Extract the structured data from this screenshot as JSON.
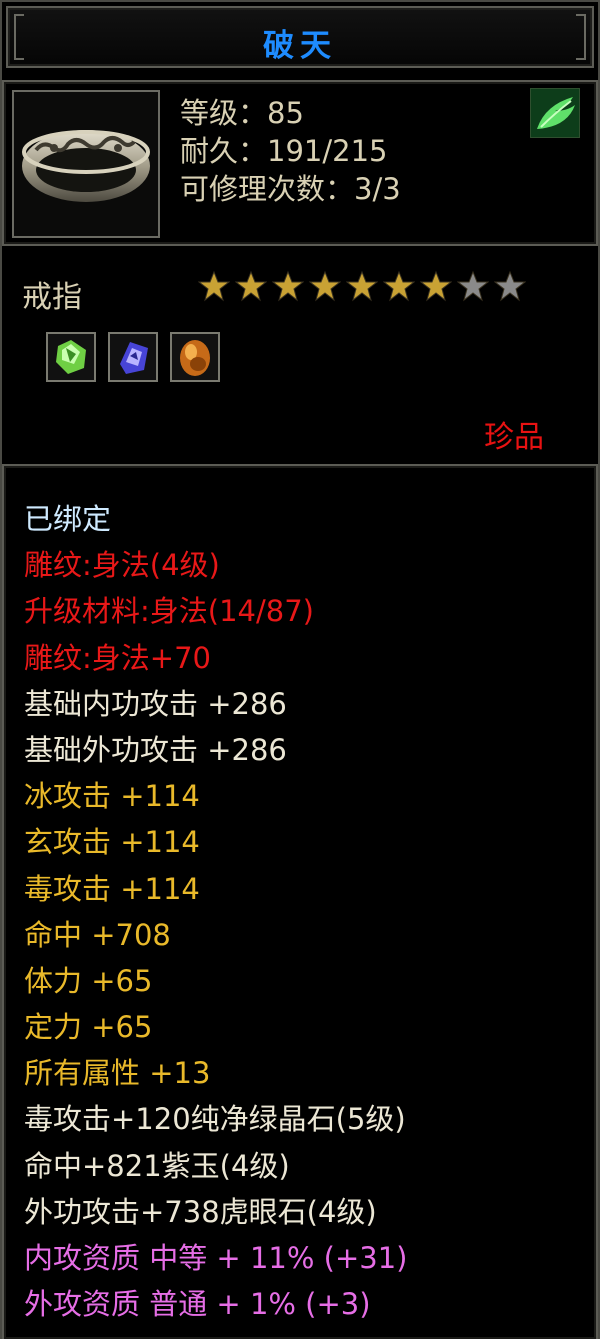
{
  "title": "破天",
  "header": {
    "level": "等级：85",
    "durability": "耐久：191/215",
    "repair_count": "可修理次数：3/3",
    "element_icon": "wind-leaf-icon",
    "item_icon": "ring-icon"
  },
  "item_type": "戒指",
  "stars": {
    "filled": 7,
    "total": 9,
    "filled_color": "#c9a234",
    "empty_color": "#8a8a8a"
  },
  "gems": [
    {
      "name": "green-crystal-gem-icon",
      "color": "#7ad84a"
    },
    {
      "name": "purple-jade-gem-icon",
      "color": "#5a58e6"
    },
    {
      "name": "tiger-eye-gem-icon",
      "color": "#d2781e"
    }
  ],
  "rarity": "珍品",
  "properties": [
    {
      "text": "已绑定",
      "color": "cyan"
    },
    {
      "text": "雕纹:身法(4级)",
      "color": "red"
    },
    {
      "text": "升级材料:身法(14/87)",
      "color": "red"
    },
    {
      "text": "雕纹:身法+70",
      "color": "red"
    },
    {
      "text": "基础内功攻击 +286",
      "color": "white"
    },
    {
      "text": "基础外功攻击 +286",
      "color": "white"
    },
    {
      "text": "冰攻击 +114",
      "color": "yellow"
    },
    {
      "text": "玄攻击 +114",
      "color": "yellow"
    },
    {
      "text": "毒攻击 +114",
      "color": "yellow"
    },
    {
      "text": "命中 +708",
      "color": "yellow"
    },
    {
      "text": "体力 +65",
      "color": "yellow"
    },
    {
      "text": "定力 +65",
      "color": "yellow"
    },
    {
      "text": "所有属性 +13",
      "color": "yellow"
    },
    {
      "text": "毒攻击+120纯净绿晶石(5级)",
      "color": "white"
    },
    {
      "text": "命中+821紫玉(4级)",
      "color": "white"
    },
    {
      "text": "外功攻击+738虎眼石(4级)",
      "color": "white"
    },
    {
      "text": "内攻资质 中等 + 11% (+31)",
      "color": "pink"
    },
    {
      "text": "外攻资质 普通 + 1% (+3)",
      "color": "pink"
    }
  ]
}
